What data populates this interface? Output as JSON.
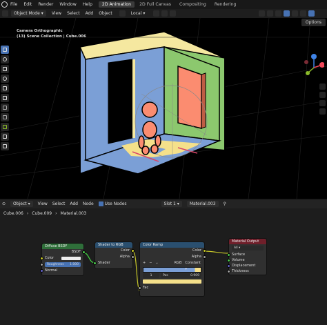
{
  "menubar": {
    "menus": [
      "File",
      "Edit",
      "Render",
      "Window",
      "Help"
    ],
    "workspaces": [
      "2D Animation",
      "2D Full Canvas",
      "Compositing",
      "Rendering"
    ],
    "active_workspace": "2D Animation"
  },
  "viewport_header": {
    "mode": "Object Mode",
    "menus": [
      "View",
      "Select",
      "Add",
      "Object"
    ],
    "transform_orientation": "Local",
    "options_label": "Options"
  },
  "viewport": {
    "camera_label": "Camera Orthographic",
    "collection_label": "(13) Scene Collection | Cube.006",
    "colors": {
      "left_wall": "#7b9fd6",
      "right_wall": "#8cc86e",
      "top_edge": "#f5e8a0",
      "floor": "#7b9fd6",
      "window": "#fb8c70",
      "character": "#fb8c70",
      "floor_light": "#f5e08a"
    }
  },
  "gizmo": {
    "axes": [
      "X",
      "Y",
      "Z"
    ],
    "colors": {
      "x": "#f0485a",
      "y": "#8bbb2a",
      "z": "#3f83e6"
    }
  },
  "node_header": {
    "object": "Object",
    "menus": [
      "View",
      "Select",
      "Add",
      "Node"
    ],
    "use_nodes": "Use Nodes",
    "slot": "Slot 1",
    "material": "Material.003"
  },
  "breadcrumbs": [
    "Cube.006",
    "Cube.009",
    "Material.003"
  ],
  "nodes": {
    "diffuse": {
      "title": "Diffuse BSDF",
      "output": "BSDF",
      "inputs": [
        "Color",
        "Roughness",
        "Normal"
      ],
      "roughness_value": "1.000",
      "header_color": "#2f6f3a"
    },
    "shader_to_rgb": {
      "title": "Shader to RGB",
      "outputs": [
        "Color",
        "Alpha"
      ],
      "input": "Shader",
      "header_color": "#2a4f6f"
    },
    "color_ramp": {
      "title": "Color Ramp",
      "outputs": [
        "Color",
        "Alpha"
      ],
      "mode": "RGB",
      "interpolation": "Constant",
      "stop_index": "1",
      "pos_label": "Pos",
      "pos_value": "0.909",
      "input": "Fac",
      "header_color": "#2a4f6f"
    },
    "output": {
      "title": "Material Output",
      "target": "All",
      "inputs": [
        "Surface",
        "Volume",
        "Displacement",
        "Thickness"
      ],
      "header_color": "#6f1f2a"
    }
  }
}
